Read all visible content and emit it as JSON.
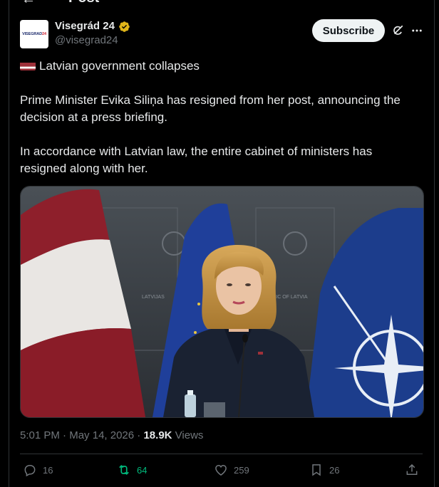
{
  "header": {
    "title": "Post",
    "back_icon": "arrow-left-icon"
  },
  "author": {
    "name": "Visegrád 24",
    "handle": "@visegrad24",
    "avatar_logo": "VISEGRAD24",
    "verified_badge_color": "#e2b719"
  },
  "buttons": {
    "subscribe": "Subscribe"
  },
  "tweet": {
    "headline": "Latvian government collapses",
    "paragraph1": "Prime Minister Evika Siliņa has resigned from her post, announcing the decision at a press briefing.",
    "paragraph2": "In accordance with Latvian law, the entire cabinet of ministers has resigned along with her."
  },
  "media": {
    "backdrop_text_left": "LATVIJAS",
    "backdrop_text_right": "PUBLIC OF LATVIA"
  },
  "meta": {
    "time": "5:01 PM",
    "separator": "·",
    "date": "May 14, 2026",
    "views_count": "18.9K",
    "views_label": "Views"
  },
  "actions": {
    "replies": "16",
    "reposts": "64",
    "likes": "259",
    "bookmarks": "26"
  },
  "colors": {
    "background": "#000000",
    "text": "#e7e9ea",
    "muted": "#71767b",
    "repost_green": "#00ba7c"
  }
}
